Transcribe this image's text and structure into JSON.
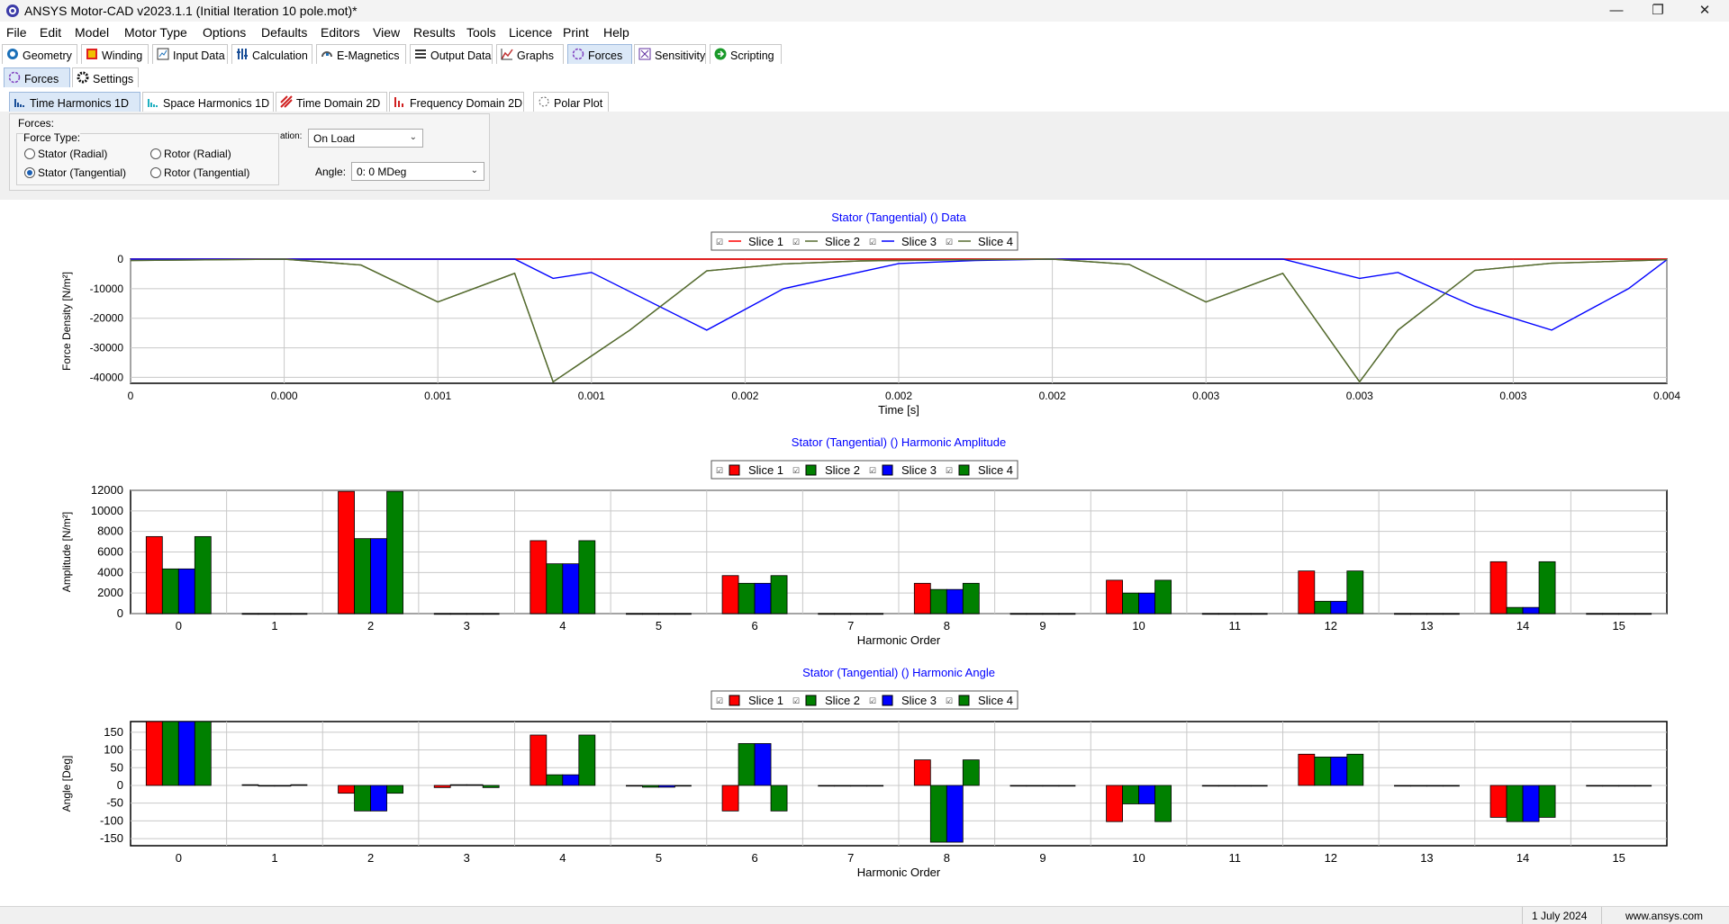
{
  "window": {
    "title": "ANSYS Motor-CAD v2023.1.1 (Initial Iteration 10 pole.mot)*"
  },
  "menu": [
    "File",
    "Edit",
    "Model",
    "Motor Type",
    "Options",
    "Defaults",
    "Editors",
    "View",
    "Results",
    "Tools",
    "Licence",
    "Print",
    "Help"
  ],
  "main_tabs": [
    "Geometry",
    "Winding",
    "Input Data",
    "Calculation",
    "E-Magnetics",
    "Output Data",
    "Graphs",
    "Forces",
    "Sensitivity",
    "Scripting"
  ],
  "active_main_tab": "Forces",
  "sub_tabs": [
    "Forces",
    "Settings"
  ],
  "chart_tabs": [
    "Time Harmonics 1D",
    "Space Harmonics 1D",
    "Time Domain 2D",
    "Frequency Domain 2D",
    "Polar Plot"
  ],
  "active_chart_tab": "Time Harmonics 1D",
  "controls": {
    "forces_label": "Forces:",
    "force_type_label": "Force Type:",
    "radios": [
      "Stator (Radial)",
      "Rotor (Radial)",
      "Stator (Tangential)",
      "Rotor (Tangential)"
    ],
    "selected_radio": "Stator (Tangential)",
    "operation_label": "ation:",
    "operation_value": "On Load",
    "angle_label": "Angle:",
    "angle_value": "0:  0 MDeg"
  },
  "status": {
    "date": "1 July 2024",
    "site": "www.ansys.com"
  },
  "colors": {
    "slice1": "#ff0000",
    "slice2": "#008000",
    "slice3": "#0000ff",
    "slice4": "#008000",
    "line2": "#556b2f",
    "title": "#0000ff"
  },
  "chart_data": [
    {
      "type": "line",
      "title": "Stator (Tangential) () Data",
      "xlabel": "Time [s]",
      "ylabel": "Force Density [N/m²]",
      "legend": [
        "Slice 1",
        "Slice 2",
        "Slice 3",
        "Slice 4"
      ],
      "xlim": [
        0,
        0.004
      ],
      "ylim": [
        -42000,
        0
      ],
      "x_tick_labels": [
        "0",
        "0.000",
        "0.001",
        "0.001",
        "0.002",
        "0.002",
        "0.002",
        "0.003",
        "0.003",
        "0.003",
        "0.004"
      ],
      "y_ticks": [
        0,
        -10000,
        -20000,
        -30000,
        -40000
      ],
      "series": [
        {
          "name": "Slice 1",
          "x": [
            0,
            0.0004,
            0.0008,
            0.0012,
            0.0016,
            0.002,
            0.0024,
            0.0028,
            0.0032,
            0.0036,
            0.004
          ],
          "y": [
            0,
            0,
            0,
            0,
            0,
            0,
            0,
            0,
            0,
            0,
            0
          ]
        },
        {
          "name": "Slice 2",
          "x": [
            0,
            0.0004,
            0.0006,
            0.0008,
            0.001,
            0.0011,
            0.0013,
            0.0015,
            0.0017,
            0.0019,
            0.0021,
            0.0024,
            0.0026,
            0.0028,
            0.003,
            0.0032,
            0.0033,
            0.0035,
            0.0037,
            0.004
          ],
          "y": [
            -500,
            0,
            -2000,
            -14500,
            -4800,
            -41500,
            -24000,
            -4000,
            -1600,
            -600,
            -300,
            0,
            -1800,
            -14500,
            -4800,
            -41500,
            -24000,
            -3800,
            -1400,
            -200
          ]
        },
        {
          "name": "Slice 3",
          "x": [
            0,
            0.0004,
            0.001,
            0.0011,
            0.0012,
            0.0015,
            0.0017,
            0.002,
            0.0022,
            0.0024,
            0.0027,
            0.003,
            0.0032,
            0.0033,
            0.0035,
            0.0037,
            0.0039,
            0.004
          ],
          "y": [
            0,
            0,
            0,
            -6500,
            -4500,
            -24000,
            -10000,
            -1500,
            -500,
            0,
            0,
            0,
            -6500,
            -4500,
            -16000,
            -24000,
            -10000,
            -200
          ]
        },
        {
          "name": "Slice 4",
          "x": [
            0,
            0.0004,
            0.0006,
            0.0008,
            0.001,
            0.0011,
            0.0013,
            0.0015,
            0.0017,
            0.0019,
            0.0021,
            0.0024,
            0.0026,
            0.0028,
            0.003,
            0.0032,
            0.0033,
            0.0035,
            0.0037,
            0.004
          ],
          "y": [
            -500,
            0,
            -2000,
            -14500,
            -4800,
            -41500,
            -24000,
            -4000,
            -1600,
            -600,
            -300,
            0,
            -1800,
            -14500,
            -4800,
            -41500,
            -24000,
            -3800,
            -1400,
            -200
          ]
        }
      ]
    },
    {
      "type": "bar",
      "title": "Stator (Tangential) () Harmonic Amplitude",
      "xlabel": "Harmonic Order",
      "ylabel": "Amplitude [N/m²]",
      "legend": [
        "Slice 1",
        "Slice 2",
        "Slice 3",
        "Slice 4"
      ],
      "ylim": [
        0,
        12000
      ],
      "y_ticks": [
        0,
        2000,
        4000,
        6000,
        8000,
        10000,
        12000
      ],
      "categories": [
        "0",
        "1",
        "2",
        "3",
        "4",
        "5",
        "6",
        "7",
        "8",
        "9",
        "10",
        "11",
        "12",
        "13",
        "14",
        "15"
      ],
      "series": [
        {
          "name": "Slice 1",
          "values": [
            7500,
            0,
            11900,
            0,
            7100,
            0,
            3700,
            0,
            2950,
            0,
            3250,
            0,
            4150,
            0,
            5050,
            0
          ]
        },
        {
          "name": "Slice 2",
          "values": [
            4350,
            0,
            7300,
            0,
            4850,
            0,
            2950,
            0,
            2350,
            0,
            2000,
            0,
            1200,
            0,
            600,
            0
          ]
        },
        {
          "name": "Slice 3",
          "values": [
            4350,
            0,
            7300,
            0,
            4850,
            0,
            2950,
            0,
            2350,
            0,
            2000,
            0,
            1200,
            0,
            600,
            0
          ]
        },
        {
          "name": "Slice 4",
          "values": [
            7500,
            0,
            11900,
            0,
            7100,
            0,
            3700,
            0,
            2950,
            0,
            3250,
            0,
            4150,
            0,
            5050,
            0
          ]
        }
      ]
    },
    {
      "type": "bar",
      "title": "Stator (Tangential) () Harmonic Angle",
      "xlabel": "Harmonic Order",
      "ylabel": "Angle [Deg]",
      "legend": [
        "Slice 1",
        "Slice 2",
        "Slice 3",
        "Slice 4"
      ],
      "ylim": [
        -170,
        180
      ],
      "y_ticks": [
        150,
        100,
        50,
        0,
        -50,
        -100,
        -150
      ],
      "categories": [
        "0",
        "1",
        "2",
        "3",
        "4",
        "5",
        "6",
        "7",
        "8",
        "9",
        "10",
        "11",
        "12",
        "13",
        "14",
        "15"
      ],
      "series": [
        {
          "name": "Slice 1",
          "values": [
            180,
            2,
            -22,
            -6,
            142,
            0,
            -72,
            -2,
            72,
            0,
            -102,
            0,
            88,
            0,
            -90,
            0
          ]
        },
        {
          "name": "Slice 2",
          "values": [
            180,
            0,
            -72,
            2,
            30,
            -5,
            118,
            -2,
            -160,
            -2,
            -52,
            0,
            80,
            0,
            -102,
            0
          ]
        },
        {
          "name": "Slice 3",
          "values": [
            180,
            0,
            -72,
            2,
            30,
            -5,
            118,
            -2,
            -160,
            -2,
            -52,
            0,
            80,
            0,
            -102,
            0
          ]
        },
        {
          "name": "Slice 4",
          "values": [
            180,
            2,
            -22,
            -6,
            142,
            0,
            -72,
            -2,
            72,
            0,
            -102,
            0,
            88,
            0,
            -90,
            0
          ]
        }
      ]
    }
  ]
}
